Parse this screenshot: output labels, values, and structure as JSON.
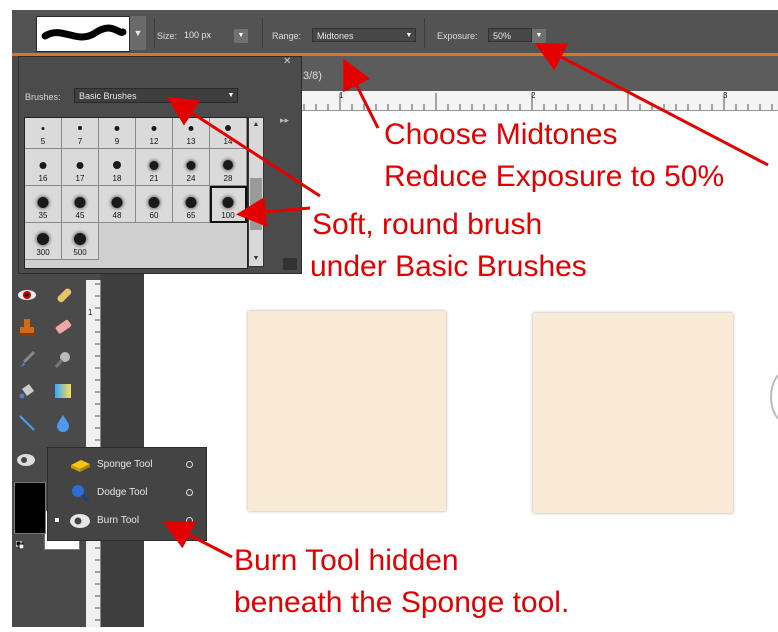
{
  "options_bar": {
    "size_label": "Size:",
    "size_value": "100 px",
    "range_label": "Range:",
    "range_value": "Midtones",
    "exposure_label": "Exposure:",
    "exposure_value": "50%"
  },
  "document_tab": {
    "title_fragment": "3/8)"
  },
  "ruler": {
    "marks": [
      "1",
      "2",
      "3"
    ],
    "vertical_mark": "1"
  },
  "brush_picker": {
    "brushes_label": "Brushes:",
    "brushes_value": "Basic Brushes",
    "selected": "100",
    "brushes": [
      {
        "size": "5",
        "dot": 3
      },
      {
        "size": "7",
        "dot": 4
      },
      {
        "size": "9",
        "dot": 5
      },
      {
        "size": "12",
        "dot": 5
      },
      {
        "size": "13",
        "dot": 5
      },
      {
        "size": "14",
        "dot": 6
      },
      {
        "size": "16",
        "dot": 7
      },
      {
        "size": "17",
        "dot": 7
      },
      {
        "size": "18",
        "dot": 8
      },
      {
        "size": "21",
        "dot": 9
      },
      {
        "size": "24",
        "dot": 9
      },
      {
        "size": "28",
        "dot": 10
      },
      {
        "size": "35",
        "dot": 11
      },
      {
        "size": "45",
        "dot": 11
      },
      {
        "size": "48",
        "dot": 11
      },
      {
        "size": "60",
        "dot": 11
      },
      {
        "size": "65",
        "dot": 11
      },
      {
        "size": "100",
        "dot": 11
      },
      {
        "size": "300",
        "dot": 12
      },
      {
        "size": "500",
        "dot": 12
      }
    ]
  },
  "tool_flyout": {
    "items": [
      {
        "label": "Sponge Tool",
        "active": false
      },
      {
        "label": "Dodge Tool",
        "active": false
      },
      {
        "label": "Burn Tool",
        "active": true
      }
    ]
  },
  "annotations": {
    "midtones_line1": "Choose Midtones",
    "midtones_line2": "Reduce Exposure to 50%",
    "brush_line1": "Soft, round brush",
    "brush_line2": "under Basic Brushes",
    "burn_line1": "Burn Tool hidden",
    "burn_line2": "beneath the Sponge tool."
  },
  "colors": {
    "annotation": "#e30000",
    "ui_dark": "#4a4a4a",
    "accent_orange": "#e2731f",
    "paper": "#f8ead4"
  }
}
